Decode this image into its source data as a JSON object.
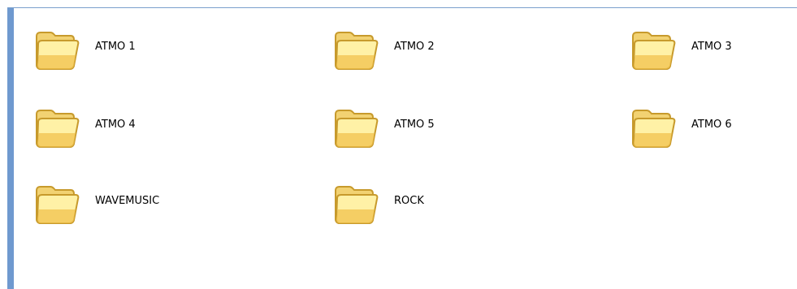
{
  "folders": [
    {
      "label": "ATMO 1",
      "icon": "folder-icon"
    },
    {
      "label": "ATMO 2",
      "icon": "folder-icon"
    },
    {
      "label": "ATMO 3",
      "icon": "folder-icon"
    },
    {
      "label": "ATMO 4",
      "icon": "folder-icon"
    },
    {
      "label": "ATMO 5",
      "icon": "folder-icon"
    },
    {
      "label": "ATMO 6",
      "icon": "folder-icon"
    },
    {
      "label": "WAVEMUSIC",
      "icon": "folder-icon"
    },
    {
      "label": "ROCK",
      "icon": "folder-icon"
    }
  ],
  "colors": {
    "left_bar": "#6f99cf",
    "folder_light": "#fff1a6",
    "folder_dark": "#f2c14e",
    "folder_edge": "#c79a2c"
  }
}
